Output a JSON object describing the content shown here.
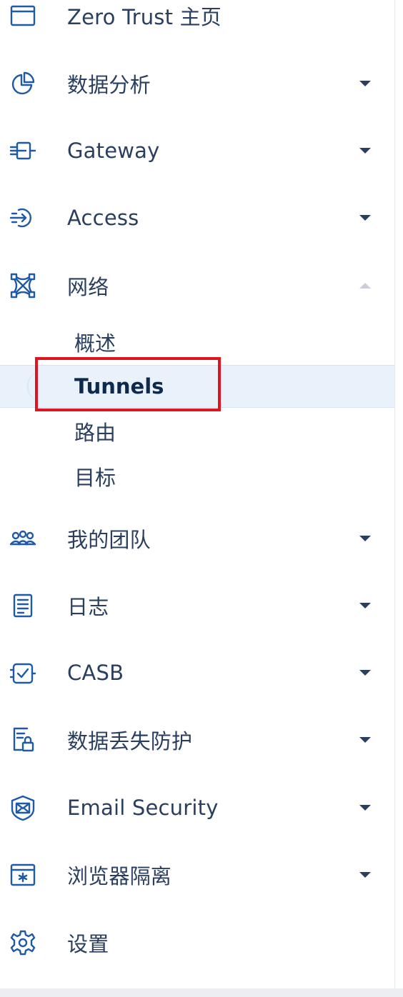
{
  "sidebar": {
    "items": [
      {
        "id": "home",
        "label": "Zero Trust 主页",
        "icon": "browser-window-icon",
        "has_chevron": false
      },
      {
        "id": "analytics",
        "label": "数据分析",
        "icon": "pie-chart-icon",
        "has_chevron": true
      },
      {
        "id": "gateway",
        "label": "Gateway",
        "icon": "gateway-icon",
        "has_chevron": true
      },
      {
        "id": "access",
        "label": "Access",
        "icon": "access-icon",
        "has_chevron": true
      },
      {
        "id": "network",
        "label": "网络",
        "icon": "network-icon",
        "has_chevron": true,
        "expanded": true
      },
      {
        "id": "team",
        "label": "我的团队",
        "icon": "team-icon",
        "has_chevron": true
      },
      {
        "id": "logs",
        "label": "日志",
        "icon": "logs-icon",
        "has_chevron": true
      },
      {
        "id": "casb",
        "label": "CASB",
        "icon": "casb-icon",
        "has_chevron": true
      },
      {
        "id": "dlp",
        "label": "数据丢失防护",
        "icon": "dlp-icon",
        "has_chevron": true
      },
      {
        "id": "email",
        "label": "Email Security",
        "icon": "email-security-icon",
        "has_chevron": true
      },
      {
        "id": "browser-isolation",
        "label": "浏览器隔离",
        "icon": "browser-isolation-icon",
        "has_chevron": true
      },
      {
        "id": "settings",
        "label": "设置",
        "icon": "gear-icon",
        "has_chevron": false
      }
    ],
    "network_subitems": [
      {
        "id": "overview",
        "label": "概述"
      },
      {
        "id": "tunnels",
        "label": "Tunnels",
        "active": true
      },
      {
        "id": "routes",
        "label": "路由"
      },
      {
        "id": "targets",
        "label": "目标"
      }
    ]
  },
  "colors": {
    "text": "#2a3f5f",
    "icon": "#1f5aa6",
    "active_bg": "#e9f1fb",
    "highlight": "#e0141e",
    "chevron": "#2a3f5f",
    "chevron_up": "#c9cfd8"
  }
}
